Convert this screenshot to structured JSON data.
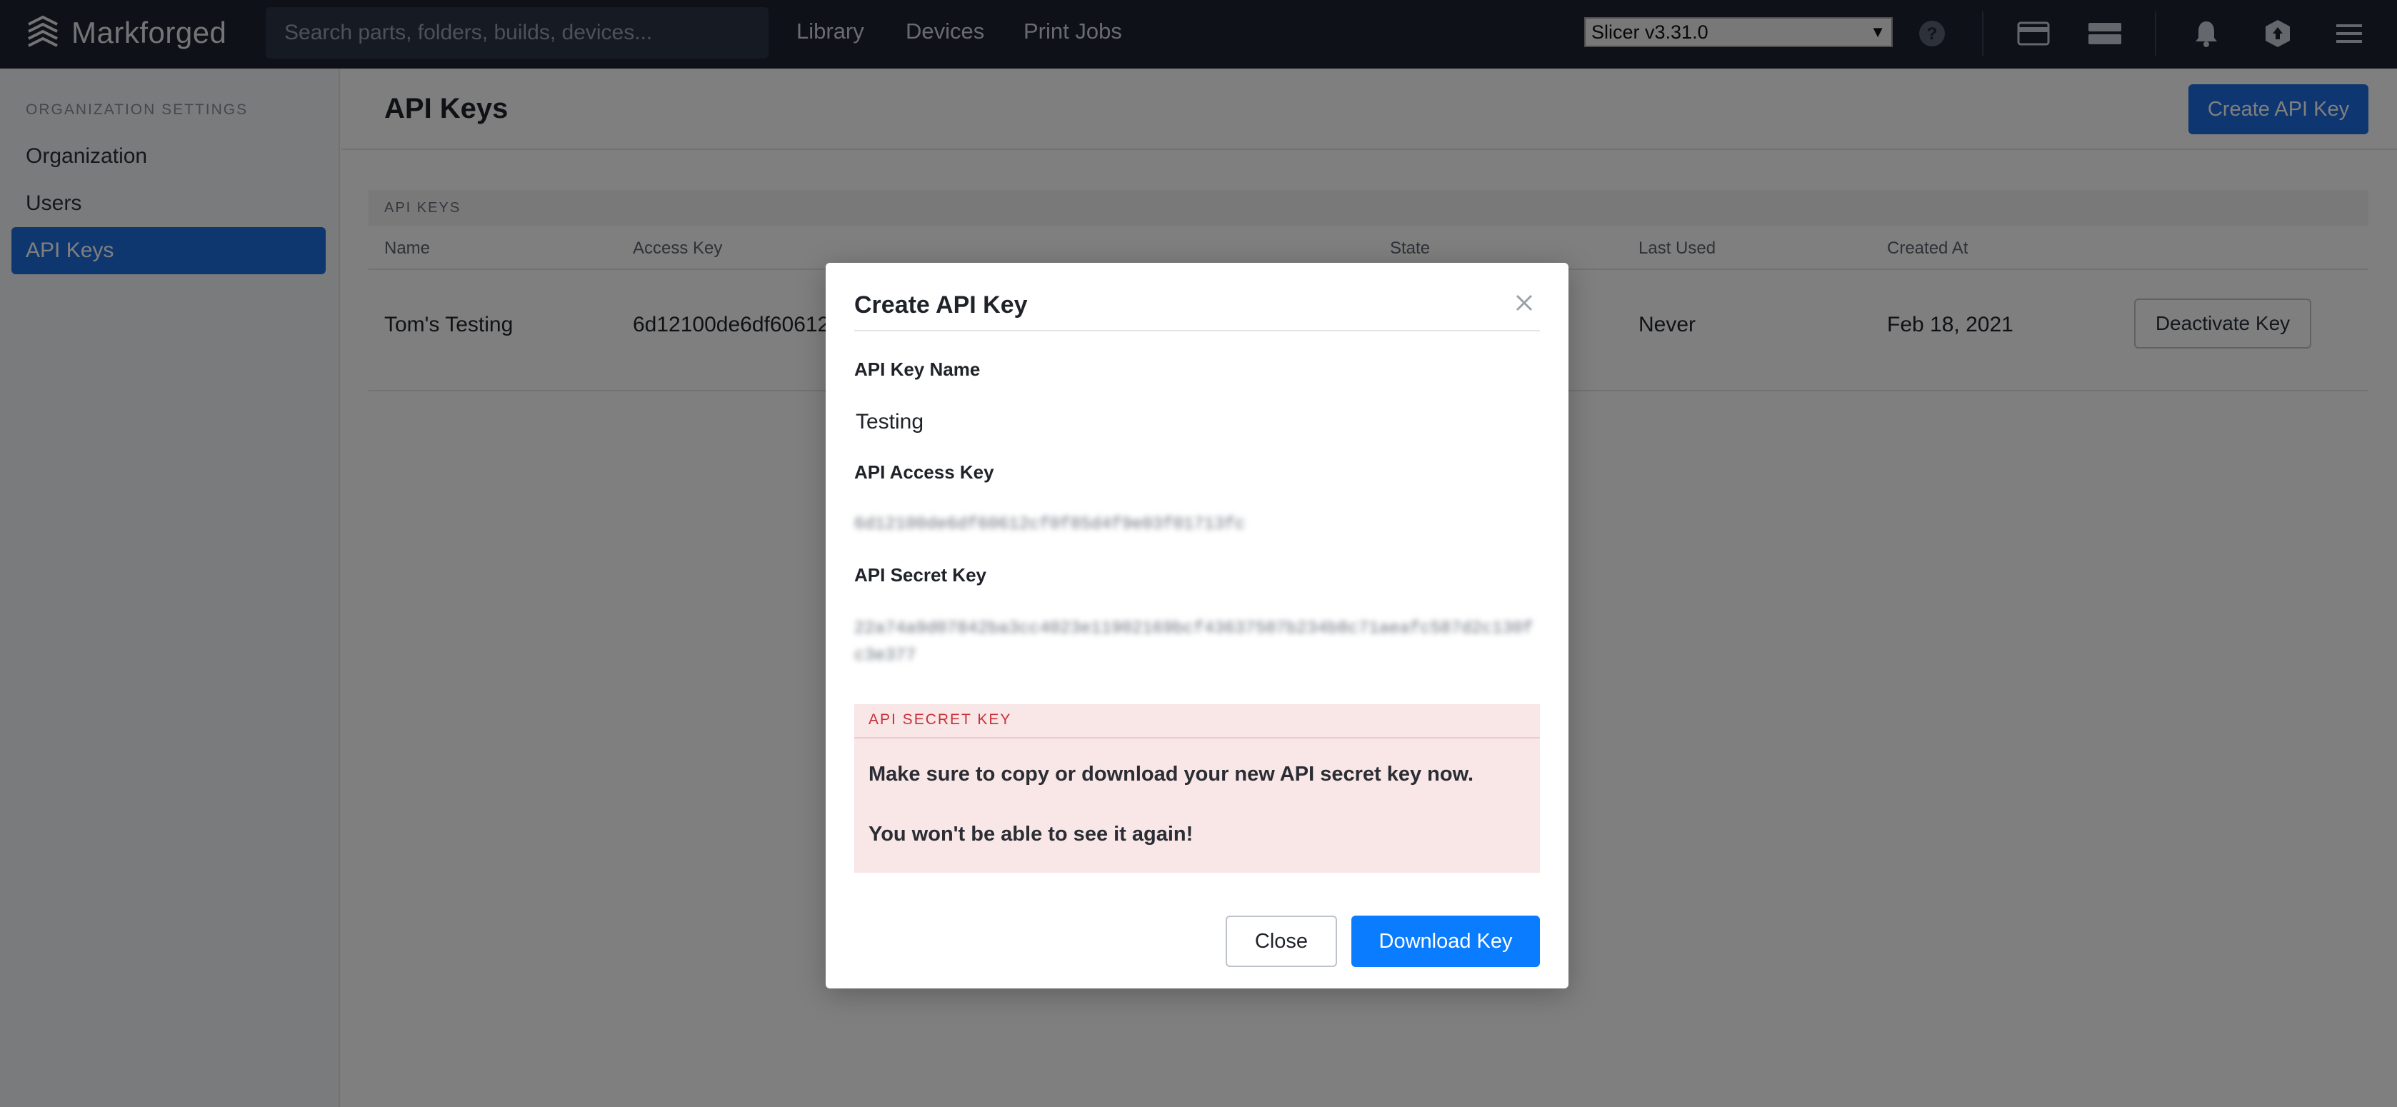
{
  "app": {
    "logo_text": "Markforged",
    "search_placeholder": "Search parts, folders, builds, devices...",
    "nav": [
      "Library",
      "Devices",
      "Print Jobs"
    ],
    "slicer_version": "Slicer v3.31.0"
  },
  "sidebar": {
    "heading": "ORGANIZATION SETTINGS",
    "items": [
      {
        "label": "Organization",
        "active": false
      },
      {
        "label": "Users",
        "active": false
      },
      {
        "label": "API Keys",
        "active": true
      }
    ]
  },
  "main": {
    "title": "API Keys",
    "create_button": "Create API Key",
    "table": {
      "section_title": "API KEYS",
      "columns": [
        "Name",
        "Access Key",
        "State",
        "Last Used",
        "Created At"
      ],
      "rows": [
        {
          "name": "Tom's Testing",
          "access_key": "6d12100de6df60612",
          "last_used": "Never",
          "created_at": "Feb 18, 2021",
          "action": "Deactivate Key"
        }
      ]
    }
  },
  "modal": {
    "title": "Create API Key",
    "name_label": "API Key Name",
    "name_value": "Testing",
    "access_label": "API Access Key",
    "access_value": "6d12100de6df60612cf0f85d4f9e03f01713fc",
    "secret_label": "API Secret Key",
    "secret_value": "22a74a9d07842ba3cc4023e11902169bcf43637507b234b8c71aeafc587d2c130fc3e377",
    "warning_title": "API SECRET KEY",
    "warning_line1": "Make sure to copy or download your new API secret key now.",
    "warning_line2": "You won't be able to see it again!",
    "close_button": "Close",
    "download_button": "Download Key"
  },
  "colors": {
    "nav_bg": "#1c2230",
    "accent": "#1e6fde",
    "download_blue": "#0a7cff",
    "warning_bg": "#f9e6e7",
    "warning_text": "#c8303a"
  },
  "icons": [
    "markforged-logo-icon",
    "help-icon",
    "card-icon",
    "printer-icon",
    "bell-icon",
    "upload-icon",
    "menu-icon",
    "close-icon"
  ]
}
